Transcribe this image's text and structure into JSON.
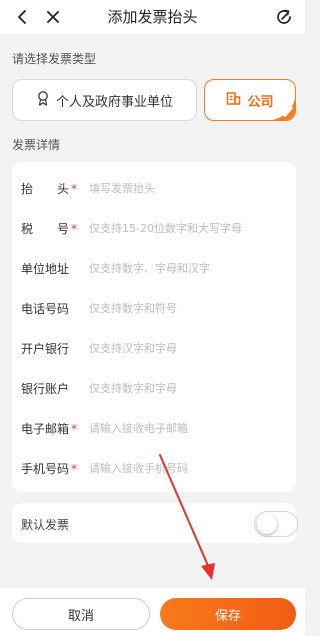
{
  "header": {
    "title": "添加发票抬头",
    "back_icon": "chevron-left-icon",
    "close_icon": "close-icon",
    "share_icon": "refresh-share-icon"
  },
  "invoice_type": {
    "section_label": "请选择发票类型",
    "options": [
      {
        "label": "个人及政府事业单位",
        "icon": "person-ribbon-icon",
        "selected": false
      },
      {
        "label": "公司",
        "icon": "building-icon",
        "selected": true
      }
    ]
  },
  "details": {
    "section_label": "发票详情",
    "fields": [
      {
        "label": "抬　　头",
        "required": true,
        "placeholder": "填写发票抬头",
        "value": ""
      },
      {
        "label": "税　　号",
        "required": true,
        "placeholder": "仅支持15-20位数字和大写字母",
        "value": ""
      },
      {
        "label": "单位地址",
        "required": false,
        "placeholder": "仅支持数字、字母和汉字",
        "value": ""
      },
      {
        "label": "电话号码",
        "required": false,
        "placeholder": "仅支持数字和符号",
        "value": ""
      },
      {
        "label": "开户银行",
        "required": false,
        "placeholder": "仅支持汉字和字母",
        "value": ""
      },
      {
        "label": "银行账户",
        "required": false,
        "placeholder": "仅支持数字和字母",
        "value": ""
      },
      {
        "label": "电子邮箱",
        "required": true,
        "placeholder": "请输入接收电子邮箱",
        "value": ""
      },
      {
        "label": "手机号码",
        "required": true,
        "placeholder": "请输入接收手机号码",
        "value": ""
      }
    ],
    "required_mark": "*"
  },
  "default_invoice": {
    "label": "默认发票",
    "enabled": false
  },
  "footer": {
    "cancel_label": "取消",
    "save_label": "保存"
  },
  "colors": {
    "accent": "#f57c1f",
    "required": "#e6392b",
    "annotation_arrow": "#e8312a"
  }
}
